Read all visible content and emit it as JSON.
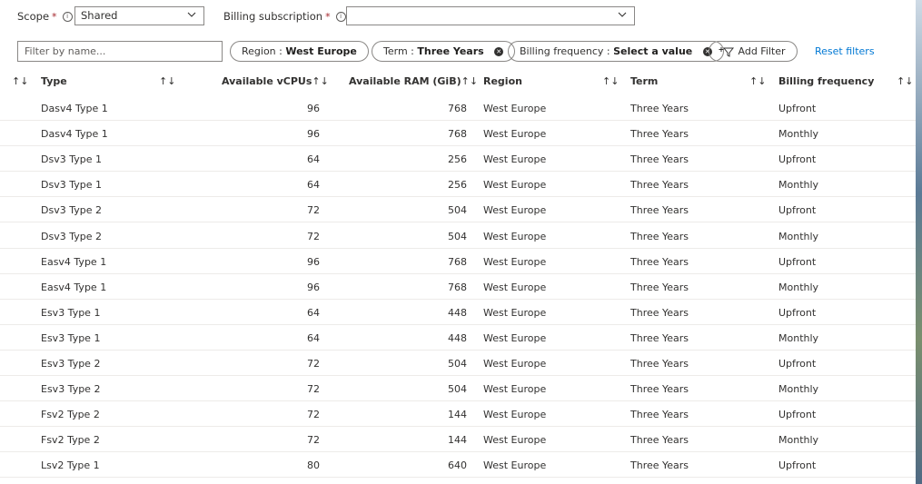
{
  "scope": {
    "label": "Scope",
    "required_mark": "*",
    "value": "Shared"
  },
  "billing_subscription": {
    "label": "Billing subscription",
    "required_mark": "*",
    "value": ""
  },
  "filter": {
    "placeholder": "Filter by name...",
    "pills": [
      {
        "key": "Region :",
        "value": "West Europe",
        "removable": false
      },
      {
        "key": "Term :",
        "value": "Three Years",
        "removable": true
      },
      {
        "key": "Billing frequency :",
        "value": "Select a value",
        "removable": true
      }
    ],
    "add_filter_label": "Add Filter",
    "reset_label": "Reset filters"
  },
  "table": {
    "sort_glyph": "↑↓",
    "columns": [
      "Type",
      "Available vCPUs",
      "Available RAM (GiB)",
      "Region",
      "Term",
      "Billing frequency"
    ],
    "rows": [
      [
        "Dasv4 Type 1",
        "96",
        "768",
        "West Europe",
        "Three Years",
        "Upfront"
      ],
      [
        "Dasv4 Type 1",
        "96",
        "768",
        "West Europe",
        "Three Years",
        "Monthly"
      ],
      [
        "Dsv3 Type 1",
        "64",
        "256",
        "West Europe",
        "Three Years",
        "Upfront"
      ],
      [
        "Dsv3 Type 1",
        "64",
        "256",
        "West Europe",
        "Three Years",
        "Monthly"
      ],
      [
        "Dsv3 Type 2",
        "72",
        "504",
        "West Europe",
        "Three Years",
        "Upfront"
      ],
      [
        "Dsv3 Type 2",
        "72",
        "504",
        "West Europe",
        "Three Years",
        "Monthly"
      ],
      [
        "Easv4 Type 1",
        "96",
        "768",
        "West Europe",
        "Three Years",
        "Upfront"
      ],
      [
        "Easv4 Type 1",
        "96",
        "768",
        "West Europe",
        "Three Years",
        "Monthly"
      ],
      [
        "Esv3 Type 1",
        "64",
        "448",
        "West Europe",
        "Three Years",
        "Upfront"
      ],
      [
        "Esv3 Type 1",
        "64",
        "448",
        "West Europe",
        "Three Years",
        "Monthly"
      ],
      [
        "Esv3 Type 2",
        "72",
        "504",
        "West Europe",
        "Three Years",
        "Upfront"
      ],
      [
        "Esv3 Type 2",
        "72",
        "504",
        "West Europe",
        "Three Years",
        "Monthly"
      ],
      [
        "Fsv2 Type 2",
        "72",
        "144",
        "West Europe",
        "Three Years",
        "Upfront"
      ],
      [
        "Fsv2 Type 2",
        "72",
        "144",
        "West Europe",
        "Three Years",
        "Monthly"
      ],
      [
        "Lsv2 Type 1",
        "80",
        "640",
        "West Europe",
        "Three Years",
        "Upfront"
      ]
    ]
  },
  "colors": {
    "accent": "#0078d4",
    "required": "#a4262c",
    "border": "#8a8886",
    "row_divider": "#edebe9"
  }
}
